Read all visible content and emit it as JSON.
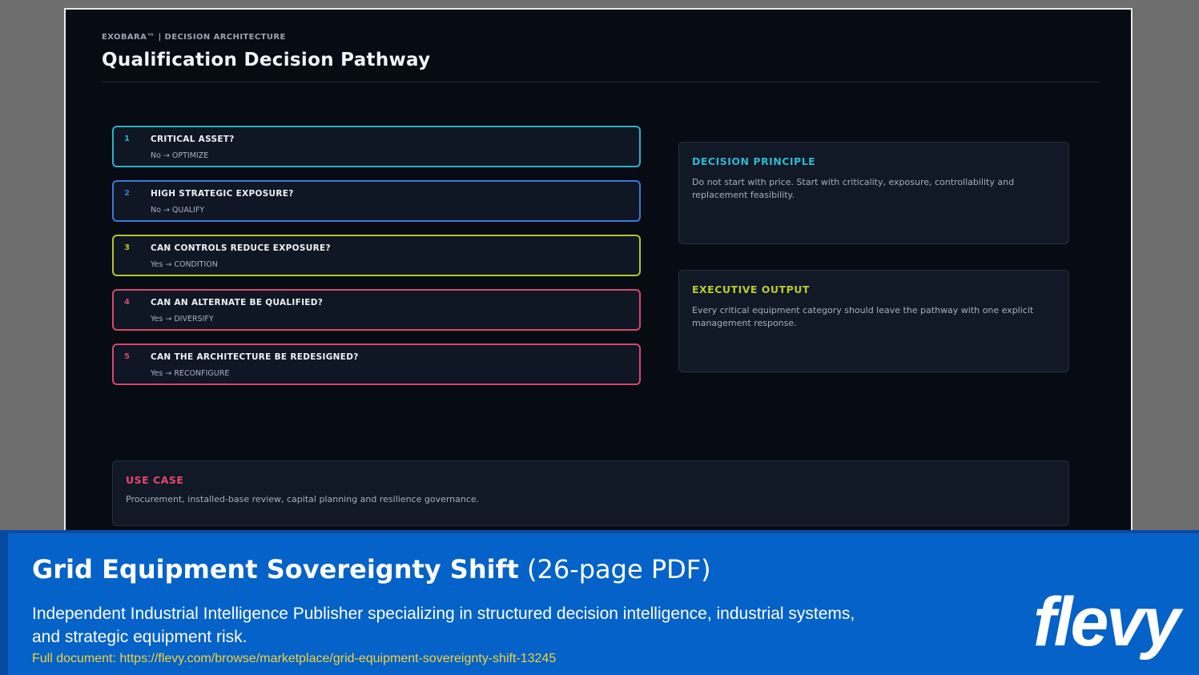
{
  "slide": {
    "kicker": "EXOBARA™ | DECISION ARCHITECTURE",
    "title": "Qualification Decision Pathway",
    "steps": [
      {
        "num": "1",
        "question": "CRITICAL ASSET?",
        "answer": "No → OPTIMIZE",
        "color": "#2bb3c9"
      },
      {
        "num": "2",
        "question": "HIGH STRATEGIC EXPOSURE?",
        "answer": "No → QUALIFY",
        "color": "#3f78d6"
      },
      {
        "num": "3",
        "question": "CAN CONTROLS REDUCE EXPOSURE?",
        "answer": "Yes → CONDITION",
        "color": "#b7c52a"
      },
      {
        "num": "4",
        "question": "CAN AN ALTERNATE BE QUALIFIED?",
        "answer": "Yes → DIVERSIFY",
        "color": "#d9466a"
      },
      {
        "num": "5",
        "question": "CAN THE ARCHITECTURE BE REDESIGNED?",
        "answer": "Yes → RECONFIGURE",
        "color": "#d9466a"
      }
    ],
    "principle": {
      "heading": "DECISION PRINCIPLE",
      "body": "Do not start with price. Start with criticality, exposure, controllability and replacement feasibility.",
      "color": "#2fb8cf"
    },
    "output": {
      "heading": "EXECUTIVE OUTPUT",
      "body": "Every critical equipment category should leave the pathway with one explicit management response.",
      "color": "#b8cc2e"
    },
    "use_case": {
      "heading": "USE CASE",
      "body": "Procurement, installed-base review, capital planning and resilience governance.",
      "color": "#e8476d"
    }
  },
  "banner": {
    "title_bold": "Grid Equipment Sovereignty Shift",
    "title_light": "(26-page PDF)",
    "description": "Independent Industrial Intelligence Publisher specializing in structured decision intelligence, industrial systems, and strategic equipment risk.",
    "link": "Full document: https://flevy.com/browse/marketplace/grid-equipment-sovereignty-shift-13245",
    "logo": "flevy"
  }
}
